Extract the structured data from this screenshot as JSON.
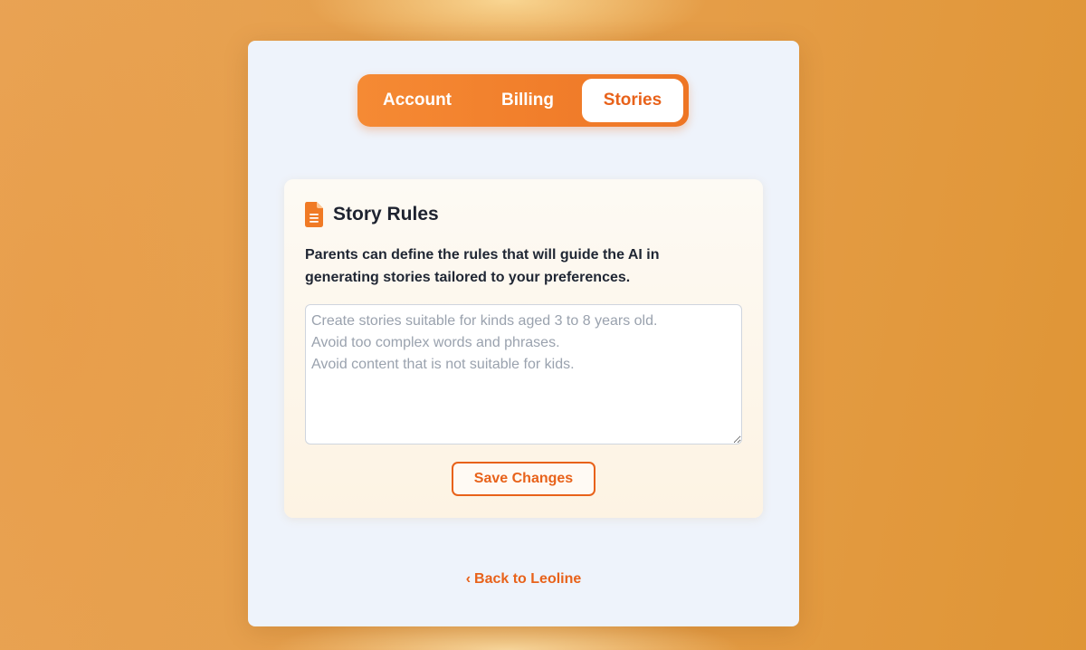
{
  "tabs": {
    "account": "Account",
    "billing": "Billing",
    "stories": "Stories",
    "active": "Stories"
  },
  "card": {
    "icon": "document-icon",
    "title": "Story Rules",
    "description": "Parents can define the rules that will guide the AI in generating stories tailored to your preferences.",
    "textarea": {
      "value": "",
      "placeholder": "Create stories suitable for kinds aged 3 to 8 years old.\nAvoid too complex words and phrases.\nAvoid content that is not suitable for kids."
    },
    "save_label": "Save Changes"
  },
  "footer": {
    "back_chevron": "‹",
    "back_label": "Back to Leoline"
  },
  "colors": {
    "accent": "#e8621a",
    "tab_gradient_start": "#f58a34",
    "tab_gradient_end": "#ee7524",
    "panel_bg": "#eef3fb",
    "page_bg": "#e59d47"
  }
}
